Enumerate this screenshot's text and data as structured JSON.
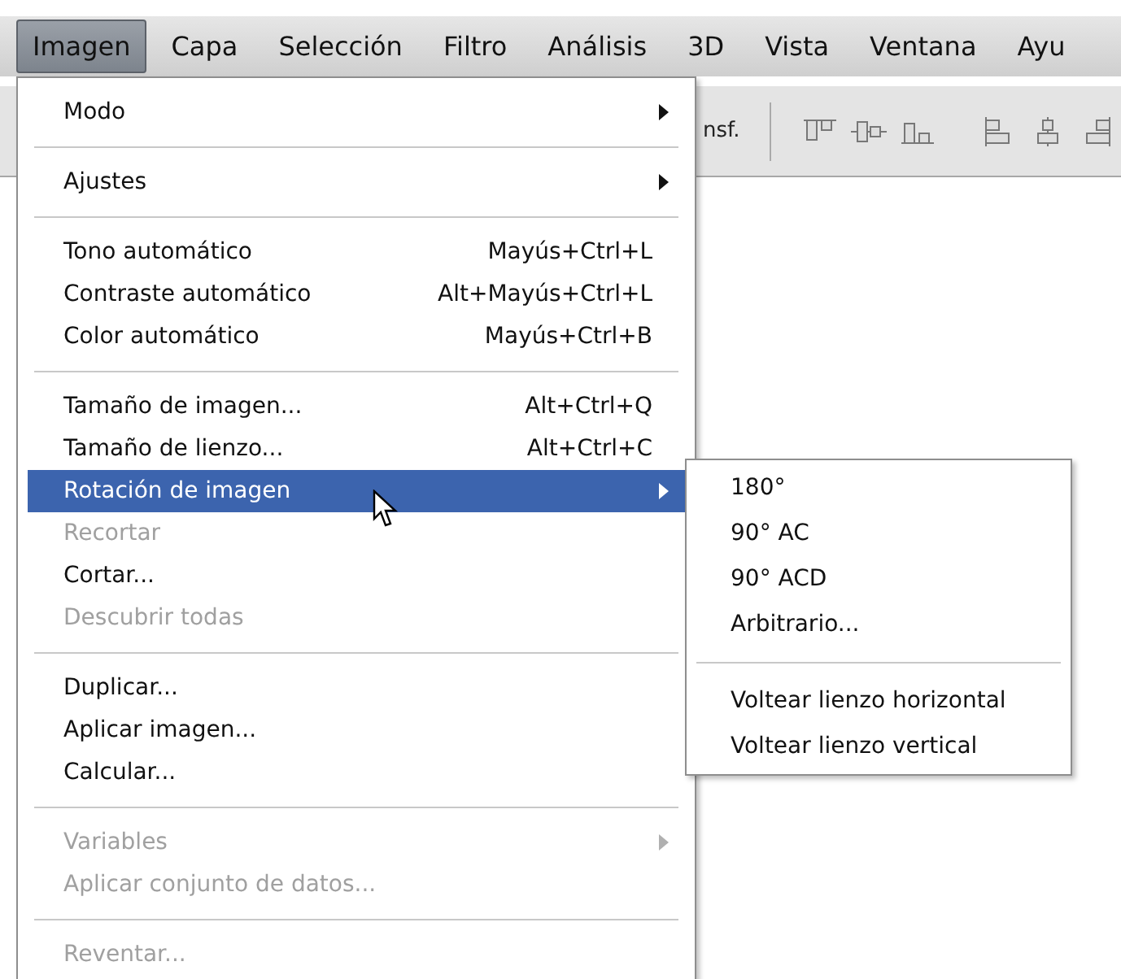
{
  "menubar": [
    {
      "label": "Imagen",
      "selected": true
    },
    {
      "label": "Capa",
      "selected": false
    },
    {
      "label": "Selección",
      "selected": false
    },
    {
      "label": "Filtro",
      "selected": false
    },
    {
      "label": "Análisis",
      "selected": false
    },
    {
      "label": "3D",
      "selected": false
    },
    {
      "label": "Vista",
      "selected": false
    },
    {
      "label": "Ventana",
      "selected": false
    },
    {
      "label": "Ayu",
      "selected": false
    }
  ],
  "toolbar": {
    "text": "nsf."
  },
  "menu": {
    "items": [
      {
        "kind": "item",
        "label": "Modo",
        "submenu": true,
        "disabled": false,
        "selected": false
      },
      {
        "kind": "separator"
      },
      {
        "kind": "item",
        "label": "Ajustes",
        "submenu": true,
        "disabled": false,
        "selected": false
      },
      {
        "kind": "separator"
      },
      {
        "kind": "item",
        "label": "Tono automático",
        "shortcut": "Mayús+Ctrl+L",
        "submenu": false,
        "disabled": false,
        "selected": false
      },
      {
        "kind": "item",
        "label": "Contraste automático",
        "shortcut": "Alt+Mayús+Ctrl+L",
        "submenu": false,
        "disabled": false,
        "selected": false
      },
      {
        "kind": "item",
        "label": "Color automático",
        "shortcut": "Mayús+Ctrl+B",
        "submenu": false,
        "disabled": false,
        "selected": false
      },
      {
        "kind": "separator"
      },
      {
        "kind": "item",
        "label": "Tamaño de imagen...",
        "shortcut": "Alt+Ctrl+Q",
        "submenu": false,
        "disabled": false,
        "selected": false
      },
      {
        "kind": "item",
        "label": "Tamaño de lienzo...",
        "shortcut": "Alt+Ctrl+C",
        "submenu": false,
        "disabled": false,
        "selected": false
      },
      {
        "kind": "item",
        "label": "Rotación de imagen",
        "submenu": true,
        "disabled": false,
        "selected": true
      },
      {
        "kind": "item",
        "label": "Recortar",
        "submenu": false,
        "disabled": true,
        "selected": false
      },
      {
        "kind": "item",
        "label": "Cortar...",
        "submenu": false,
        "disabled": false,
        "selected": false
      },
      {
        "kind": "item",
        "label": "Descubrir todas",
        "submenu": false,
        "disabled": true,
        "selected": false
      },
      {
        "kind": "separator"
      },
      {
        "kind": "item",
        "label": "Duplicar...",
        "submenu": false,
        "disabled": false,
        "selected": false
      },
      {
        "kind": "item",
        "label": "Aplicar imagen...",
        "submenu": false,
        "disabled": false,
        "selected": false
      },
      {
        "kind": "item",
        "label": "Calcular...",
        "submenu": false,
        "disabled": false,
        "selected": false
      },
      {
        "kind": "separator"
      },
      {
        "kind": "item",
        "label": "Variables",
        "submenu": true,
        "disabled": true,
        "selected": false
      },
      {
        "kind": "item",
        "label": "Aplicar conjunto de datos...",
        "submenu": false,
        "disabled": true,
        "selected": false
      },
      {
        "kind": "separator"
      },
      {
        "kind": "item",
        "label": "Reventar...",
        "submenu": false,
        "disabled": true,
        "selected": false
      }
    ]
  },
  "submenu": {
    "items": [
      {
        "kind": "item",
        "label": "180°"
      },
      {
        "kind": "item",
        "label": "90° AC"
      },
      {
        "kind": "item",
        "label": "90° ACD"
      },
      {
        "kind": "item",
        "label": "Arbitrario..."
      },
      {
        "kind": "separator"
      },
      {
        "kind": "item",
        "label": "Voltear lienzo horizontal"
      },
      {
        "kind": "item",
        "label": "Voltear lienzo vertical"
      }
    ]
  }
}
